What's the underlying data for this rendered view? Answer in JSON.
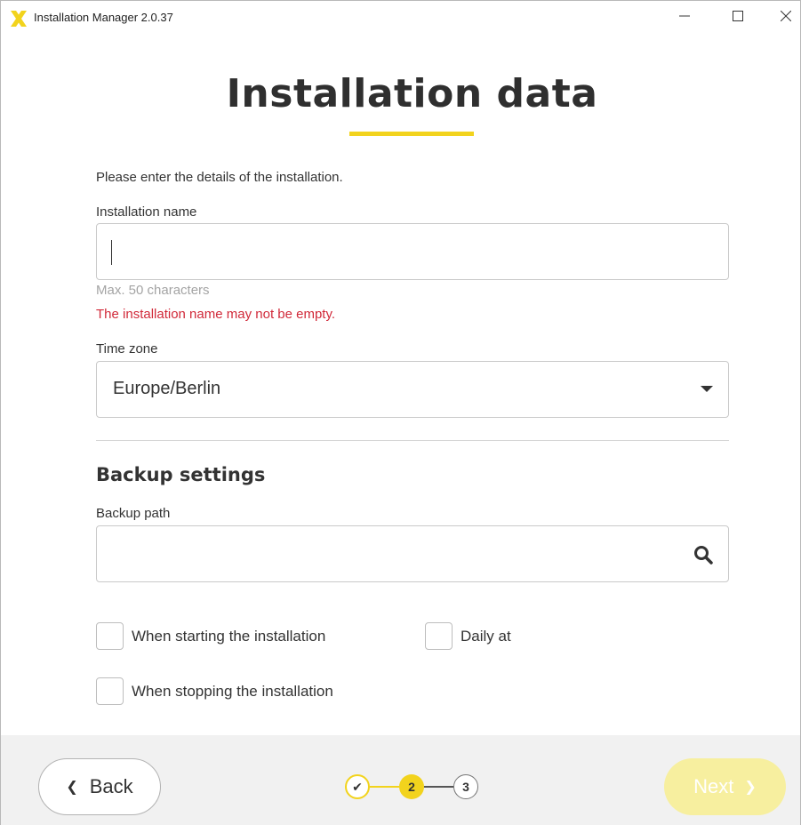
{
  "window": {
    "title": "Installation Manager 2.0.37",
    "brand_color": "#f2d31d"
  },
  "page": {
    "heading": "Installation data",
    "intro": "Please enter the details of the installation."
  },
  "installation_name": {
    "label": "Installation name",
    "value": "",
    "hint": "Max. 50 characters",
    "error": "The installation name may not be empty.",
    "error_color": "#d12a3a"
  },
  "time_zone": {
    "label": "Time zone",
    "selected": "Europe/Berlin"
  },
  "backup": {
    "section_title": "Backup settings",
    "path_label": "Backup path",
    "path_value": "",
    "search_icon": "search-icon",
    "options": [
      {
        "label": "When starting the installation",
        "checked": false
      },
      {
        "label": "Daily at",
        "checked": false
      },
      {
        "label": "When stopping the installation",
        "checked": false
      }
    ]
  },
  "footer": {
    "back_label": "Back",
    "next_label": "Next",
    "steps": [
      {
        "label": "✔",
        "state": "done"
      },
      {
        "label": "2",
        "state": "current"
      },
      {
        "label": "3",
        "state": "upcoming"
      }
    ]
  }
}
